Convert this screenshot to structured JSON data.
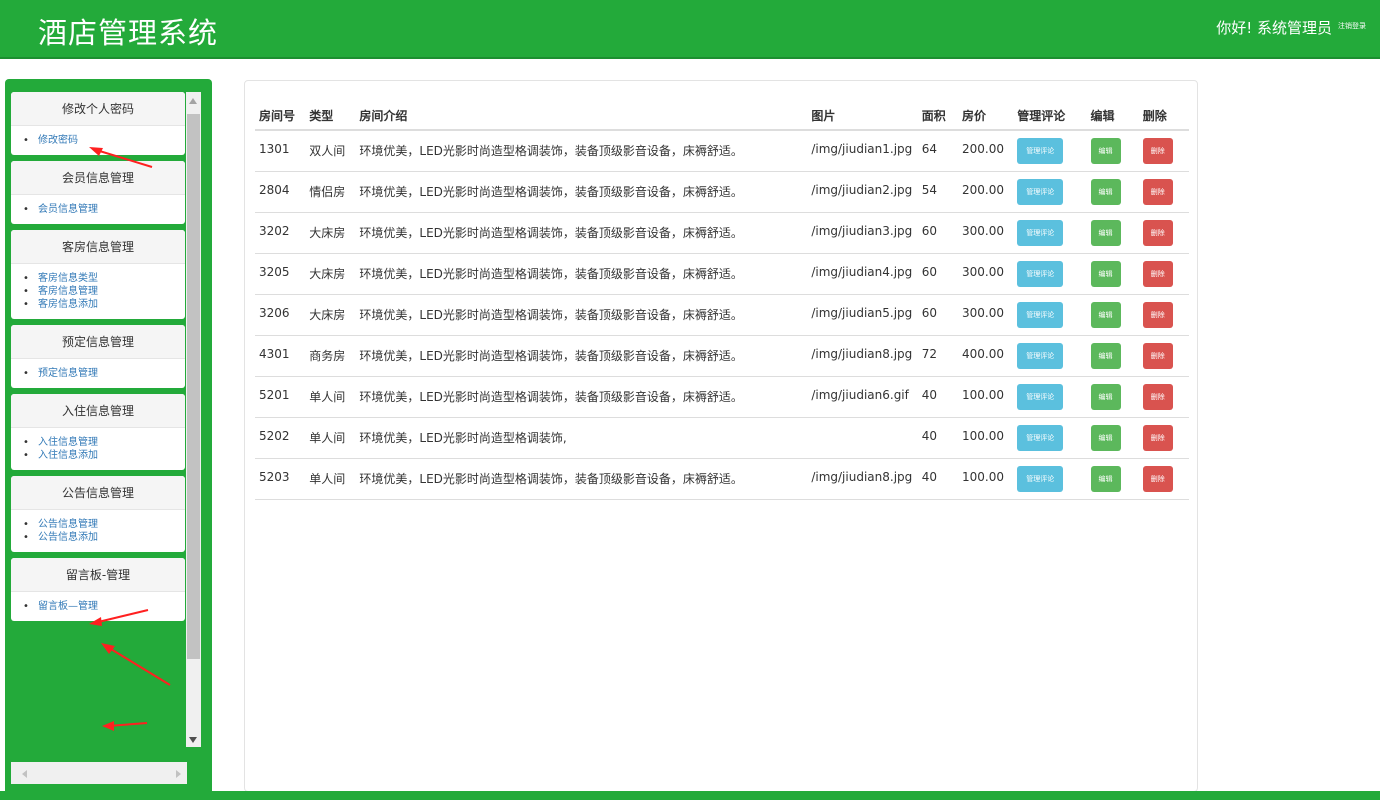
{
  "app": {
    "title": "酒店管理系统",
    "greeting": "你好! 系统管理员",
    "logout": "注销登录"
  },
  "colors": {
    "brand": "#23aa3a",
    "info": "#5bc0de",
    "success": "#5cb85c",
    "danger": "#d9534f",
    "link": "#337ab7"
  },
  "sidebar": {
    "panels": [
      {
        "title": "修改个人密码",
        "items": [
          "修改密码"
        ]
      },
      {
        "title": "会员信息管理",
        "items": [
          "会员信息管理"
        ]
      },
      {
        "title": "客房信息管理",
        "items": [
          "客房信息类型",
          "客房信息管理",
          "客房信息添加"
        ]
      },
      {
        "title": "预定信息管理",
        "items": [
          "预定信息管理"
        ]
      },
      {
        "title": "入住信息管理",
        "items": [
          "入住信息管理",
          "入住信息添加"
        ]
      },
      {
        "title": "公告信息管理",
        "items": [
          "公告信息管理",
          "公告信息添加"
        ]
      },
      {
        "title": "留言板-管理",
        "items": [
          "留言板—管理"
        ]
      }
    ]
  },
  "table": {
    "headers": [
      "房间号",
      "类型",
      "房间介绍",
      "图片",
      "面积",
      "房价",
      "管理评论",
      "编辑",
      "删除"
    ],
    "buttons": {
      "comment": "管理评论",
      "edit": "编辑",
      "delete": "删除"
    },
    "rows": [
      {
        "room": "1301",
        "type": "双人间",
        "intro": "环境优美，LED光影时尚造型格调装饰，装备顶级影音设备，床褥舒适。",
        "image": "/img/jiudian1.jpg",
        "area": "64",
        "price": "200.00"
      },
      {
        "room": "2804",
        "type": "情侣房",
        "intro": "环境优美，LED光影时尚造型格调装饰，装备顶级影音设备，床褥舒适。",
        "image": "/img/jiudian2.jpg",
        "area": "54",
        "price": "200.00"
      },
      {
        "room": "3202",
        "type": "大床房",
        "intro": "环境优美，LED光影时尚造型格调装饰，装备顶级影音设备，床褥舒适。",
        "image": "/img/jiudian3.jpg",
        "area": "60",
        "price": "300.00"
      },
      {
        "room": "3205",
        "type": "大床房",
        "intro": "环境优美，LED光影时尚造型格调装饰，装备顶级影音设备，床褥舒适。",
        "image": "/img/jiudian4.jpg",
        "area": "60",
        "price": "300.00"
      },
      {
        "room": "3206",
        "type": "大床房",
        "intro": "环境优美，LED光影时尚造型格调装饰，装备顶级影音设备，床褥舒适。",
        "image": "/img/jiudian5.jpg",
        "area": "60",
        "price": "300.00"
      },
      {
        "room": "4301",
        "type": "商务房",
        "intro": "环境优美，LED光影时尚造型格调装饰，装备顶级影音设备，床褥舒适。",
        "image": "/img/jiudian8.jpg",
        "area": "72",
        "price": "400.00"
      },
      {
        "room": "5201",
        "type": "单人间",
        "intro": "环境优美，LED光影时尚造型格调装饰，装备顶级影音设备，床褥舒适。",
        "image": "/img/jiudian6.gif",
        "area": "40",
        "price": "100.00"
      },
      {
        "room": "5202",
        "type": "单人间",
        "intro": "环境优美，LED光影时尚造型格调装饰,",
        "image": "",
        "area": "40",
        "price": "100.00"
      },
      {
        "room": "5203",
        "type": "单人间",
        "intro": "环境优美，LED光影时尚造型格调装饰，装备顶级影音设备，床褥舒适。",
        "image": "/img/jiudian8.jpg",
        "area": "40",
        "price": "100.00"
      }
    ]
  }
}
